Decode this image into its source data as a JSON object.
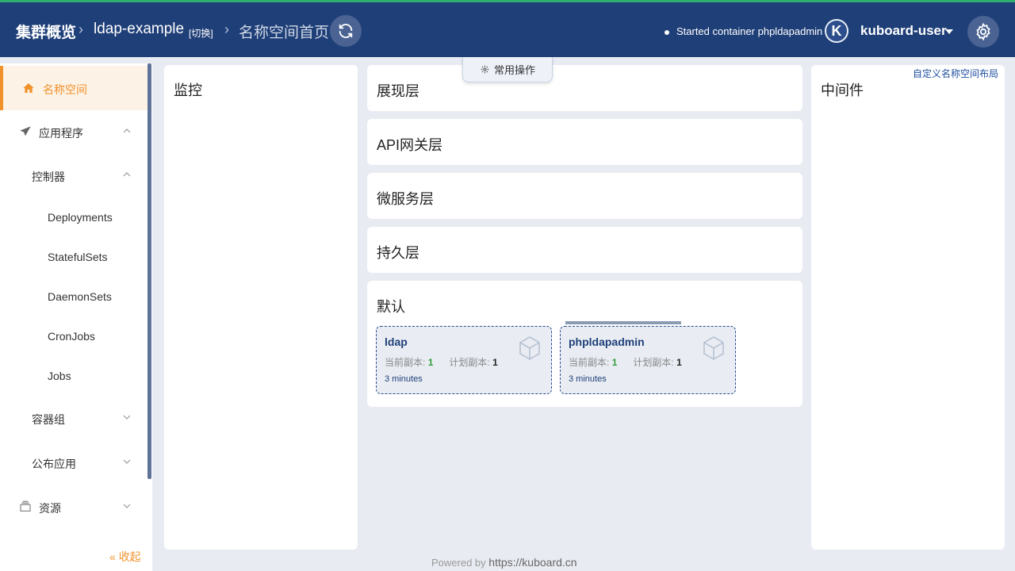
{
  "header": {
    "cluster_title": "集群概览",
    "namespace": "ldap-example",
    "switch_label": "[切换]",
    "page_title": "名称空间首页",
    "status_text": "Started container phpldapadmin",
    "avatar_letter": "K",
    "username": "kuboard-user",
    "accent_color": "#2fae71",
    "bg_color": "#1f3f78"
  },
  "sidebar": {
    "items": [
      {
        "label": "名称空间",
        "icon": "home-icon"
      },
      {
        "label": "应用程序",
        "icon": "paper-plane-icon"
      },
      {
        "label": "控制器"
      },
      {
        "label": "Deployments"
      },
      {
        "label": "StatefulSets"
      },
      {
        "label": "DaemonSets"
      },
      {
        "label": "CronJobs"
      },
      {
        "label": "Jobs"
      },
      {
        "label": "容器组"
      },
      {
        "label": "公布应用"
      },
      {
        "label": "资源",
        "icon": "box-icon"
      }
    ],
    "collapse_label": "收起",
    "active_color": "#f0922c"
  },
  "main": {
    "ops_label": "常用操作",
    "custom_layout_link": "自定义名称空间布局",
    "monitor_title": "监控",
    "layers": [
      "展现层",
      "API网关层",
      "微服务层",
      "持久层"
    ],
    "default_title": "默认",
    "middleware_title": "中间件",
    "workloads": [
      {
        "name": "ldap",
        "current_label": "当前副本:",
        "current": "1",
        "planned_label": "计划副本:",
        "planned": "1",
        "age": "3 minutes"
      },
      {
        "name": "phpldapadmin",
        "current_label": "当前副本:",
        "current": "1",
        "planned_label": "计划副本:",
        "planned": "1",
        "age": "3 minutes"
      }
    ]
  },
  "footer": {
    "powered_by": "Powered by",
    "url": "https://kuboard.cn"
  }
}
